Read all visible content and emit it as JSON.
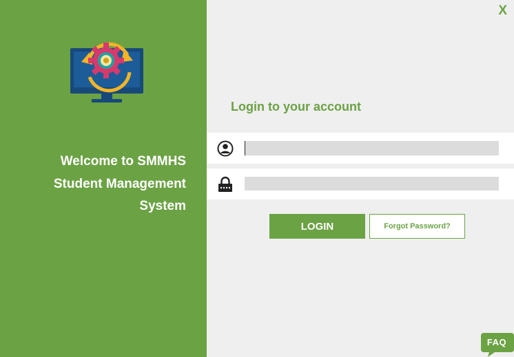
{
  "window": {
    "close_label": "X"
  },
  "sidebar": {
    "logo_icon": "monitor-gear-sync-icon",
    "welcome_lines": [
      "Welcome to SMMHS",
      "Student Management",
      "System"
    ]
  },
  "login": {
    "heading": "Login to your account",
    "username": {
      "icon": "user-icon",
      "value": "",
      "placeholder": ""
    },
    "password": {
      "icon": "lock-icon",
      "value": "",
      "placeholder": ""
    },
    "login_label": "LOGIN",
    "forgot_label": "Forgot Password?"
  },
  "faq": {
    "label": "FAQ"
  },
  "colors": {
    "accent": "#6ba244",
    "background": "#efefef",
    "input_fill": "#dcdcdc",
    "monitor": "#17497a",
    "gear": "#d63a6c",
    "arrows": "#f3b426"
  }
}
